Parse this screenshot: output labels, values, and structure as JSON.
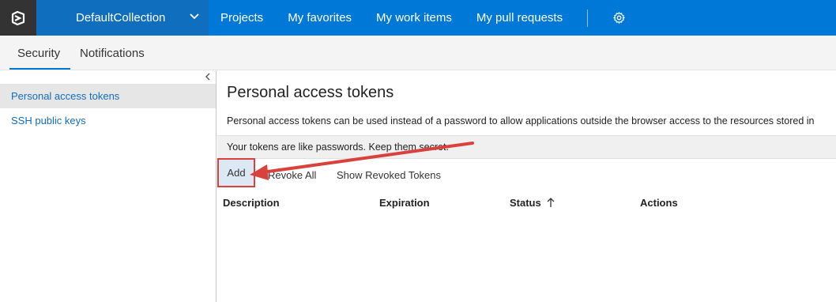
{
  "topbar": {
    "collection_label": "DefaultCollection",
    "nav": [
      {
        "label": "Projects"
      },
      {
        "label": "My favorites"
      },
      {
        "label": "My work items"
      },
      {
        "label": "My pull requests"
      }
    ]
  },
  "subtabs": {
    "security": "Security",
    "notifications": "Notifications"
  },
  "sidebar": {
    "items": [
      {
        "label": "Personal access tokens",
        "selected": true
      },
      {
        "label": "SSH public keys",
        "selected": false
      }
    ]
  },
  "main": {
    "title": "Personal access tokens",
    "description": "Personal access tokens can be used instead of a password to allow applications outside the browser access to the resources stored in",
    "warning": "Your tokens are like passwords. Keep them secret.",
    "toolbar": {
      "add": "Add",
      "revoke_all": "Revoke All",
      "show_revoked": "Show Revoked Tokens"
    },
    "columns": [
      "Description",
      "Expiration",
      "Status",
      "Actions"
    ]
  },
  "colors": {
    "topbar": "#0078d7",
    "collection_bg": "#106ebe",
    "logo_bg": "#333333",
    "highlight_box": "#d9423c",
    "arrow": "#d9423c"
  },
  "icons": [
    "vsts-logo-icon",
    "chevron-down-icon",
    "gear-icon",
    "chevron-left-icon",
    "sort-ascending-icon"
  ]
}
